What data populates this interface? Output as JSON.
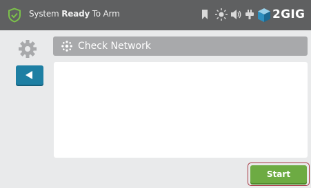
{
  "status_bar": {
    "prefix": "System",
    "state": "Ready",
    "suffix": "To Arm",
    "status_icon": "shield-check-icon",
    "icons": [
      "bookmark-icon",
      "brightness-icon",
      "volume-icon",
      "power-plug-icon"
    ],
    "brand": "2GIG",
    "brand_icon": "cube-logo-icon"
  },
  "sidebar": {
    "settings_icon": "gear-icon",
    "back_icon": "back-arrow-icon"
  },
  "panel": {
    "title": "Check Network",
    "title_icon": "network-icon"
  },
  "actions": {
    "start_label": "Start"
  },
  "colors": {
    "topbar": "#5f6061",
    "accent_green": "#6dab43",
    "back_blue": "#1e7fa3",
    "highlight_red": "#a4303b",
    "shield_green": "#7cc24a"
  }
}
